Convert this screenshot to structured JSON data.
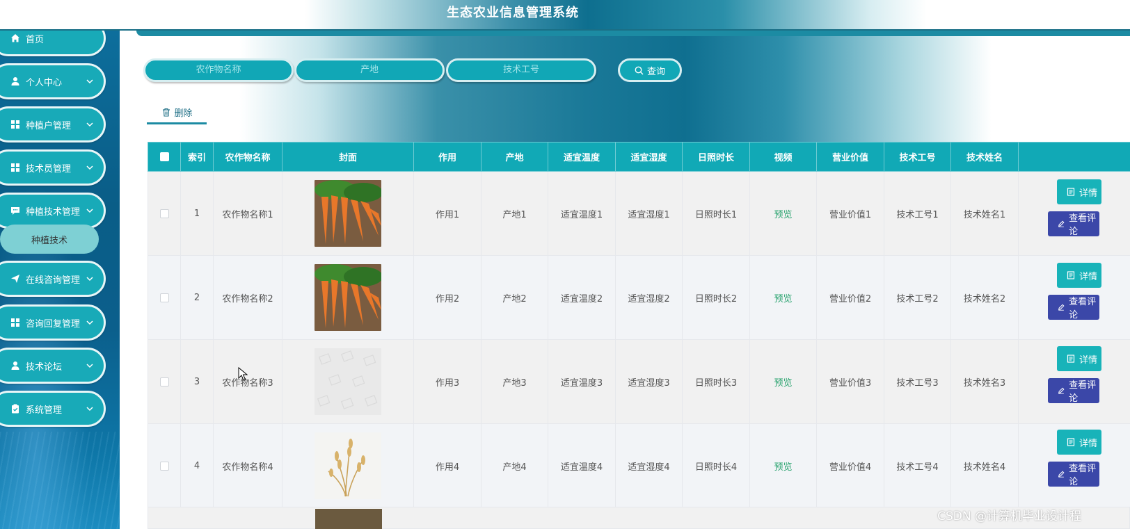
{
  "header": {
    "title": "生态农业信息管理系统"
  },
  "sidebar": {
    "items": [
      {
        "label": "首页",
        "icon": "home-icon"
      },
      {
        "label": "个人中心",
        "icon": "user-icon"
      },
      {
        "label": "种植户管理",
        "icon": "grid-icon"
      },
      {
        "label": "技术员管理",
        "icon": "grid-icon"
      },
      {
        "label": "种植技术管理",
        "icon": "chat-icon"
      },
      {
        "label": "在线咨询管理",
        "icon": "send-icon"
      },
      {
        "label": "咨询回复管理",
        "icon": "grid-icon"
      },
      {
        "label": "技术论坛",
        "icon": "user-icon"
      },
      {
        "label": "系统管理",
        "icon": "clipboard-icon"
      }
    ],
    "submenu": {
      "label": "种植技术"
    }
  },
  "search": {
    "crop_name_placeholder": "农作物名称",
    "origin_placeholder": "产地",
    "tech_id_placeholder": "技术工号",
    "button_label": "查询"
  },
  "toolbar": {
    "delete_label": "删除"
  },
  "table": {
    "headers": [
      "索引",
      "农作物名称",
      "封面",
      "作用",
      "产地",
      "适宜温度",
      "适宜湿度",
      "日照时长",
      "视频",
      "营业价值",
      "技术工号",
      "技术姓名"
    ],
    "rows": [
      {
        "index": "1",
        "name": "农作物名称1",
        "cover": "carrot",
        "effect": "作用1",
        "origin": "产地1",
        "temp": "适宜温度1",
        "humidity": "适宜湿度1",
        "sunlight": "日照时长1",
        "video": "预览",
        "value": "营业价值1",
        "tech_id": "技术工号1",
        "tech_name": "技术姓名1"
      },
      {
        "index": "2",
        "name": "农作物名称2",
        "cover": "carrot",
        "effect": "作用2",
        "origin": "产地2",
        "temp": "适宜温度2",
        "humidity": "适宜湿度2",
        "sunlight": "日照时长2",
        "video": "预览",
        "value": "营业价值2",
        "tech_id": "技术工号2",
        "tech_name": "技术姓名2"
      },
      {
        "index": "3",
        "name": "农作物名称3",
        "cover": "placeholder",
        "effect": "作用3",
        "origin": "产地3",
        "temp": "适宜温度3",
        "humidity": "适宜湿度3",
        "sunlight": "日照时长3",
        "video": "预览",
        "value": "营业价值3",
        "tech_id": "技术工号3",
        "tech_name": "技术姓名3"
      },
      {
        "index": "4",
        "name": "农作物名称4",
        "cover": "wheat",
        "effect": "作用4",
        "origin": "产地4",
        "temp": "适宜温度4",
        "humidity": "适宜湿度4",
        "sunlight": "日照时长4",
        "video": "预览",
        "value": "营业价值4",
        "tech_id": "技术工号4",
        "tech_name": "技术姓名4"
      }
    ],
    "actions": {
      "detail_label": "详情",
      "view_label": "查看评论"
    }
  },
  "watermark": "CSDN @计算机毕业设计程",
  "colors": {
    "teal": "#11a9b6",
    "indigo": "#3b47a8",
    "preview_green": "#2aa36f"
  }
}
